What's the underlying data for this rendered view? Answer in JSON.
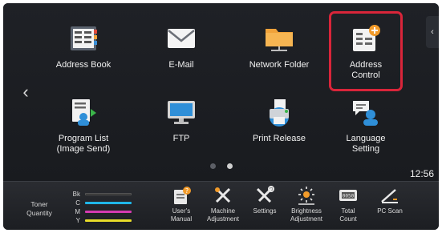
{
  "home": {
    "apps": [
      {
        "label": "Address Book",
        "icon": "address-book-icon"
      },
      {
        "label": "E-Mail",
        "icon": "email-icon"
      },
      {
        "label": "Network Folder",
        "icon": "network-folder-icon"
      },
      {
        "label": "Address\nControl",
        "icon": "address-control-icon"
      },
      {
        "label": "Program List\n(Image Send)",
        "icon": "program-list-icon"
      },
      {
        "label": "FTP",
        "icon": "ftp-icon"
      },
      {
        "label": "Print Release",
        "icon": "print-release-icon"
      },
      {
        "label": "Language\nSetting",
        "icon": "language-setting-icon"
      }
    ],
    "page_count": 2,
    "current_page": 2,
    "clock": "12:56",
    "highlighted_app": "Address Control"
  },
  "bottom_bar": {
    "toner": {
      "label": "Toner\nQuantity",
      "channels": [
        {
          "code": "Bk",
          "color": "#2c2c2c"
        },
        {
          "code": "C",
          "color": "#1fb6e8"
        },
        {
          "code": "M",
          "color": "#d43ab0"
        },
        {
          "code": "Y",
          "color": "#e8dc2a"
        }
      ]
    },
    "buttons": [
      {
        "label": "User's\nManual",
        "icon": "users-manual-icon"
      },
      {
        "label": "Machine\nAdjustment",
        "icon": "machine-adjustment-icon"
      },
      {
        "label": "Settings",
        "icon": "settings-icon"
      },
      {
        "label": "Brightness\nAdjustment",
        "icon": "brightness-icon"
      },
      {
        "label": "Total\nCount",
        "icon": "total-count-icon"
      },
      {
        "label": "PC Scan",
        "icon": "pc-scan-icon"
      }
    ]
  },
  "colors": {
    "highlight": "#d9253a",
    "accent_orange": "#f29b2a",
    "accent_blue": "#2f8fd8"
  }
}
